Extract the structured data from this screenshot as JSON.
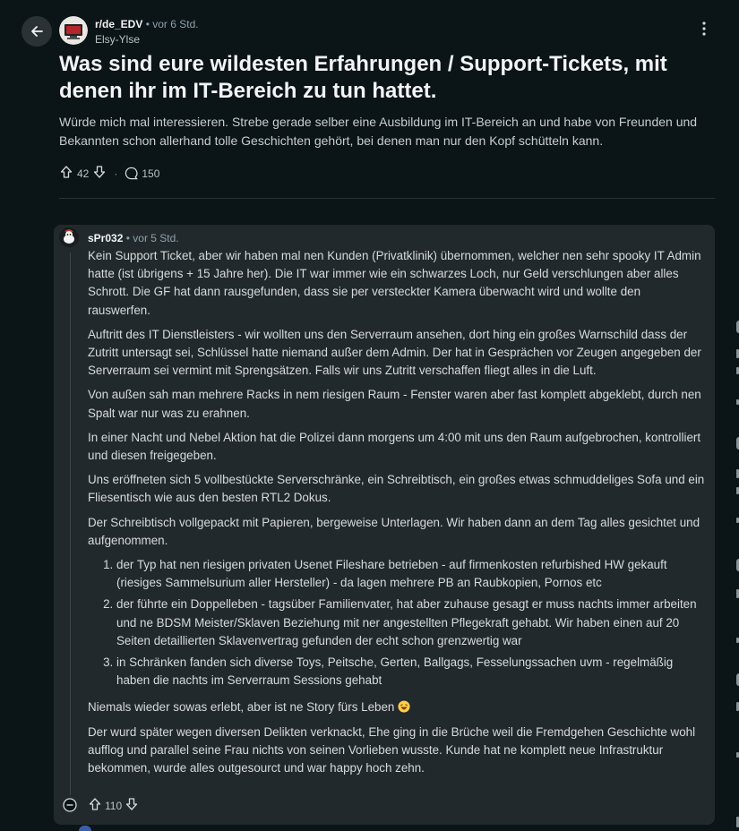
{
  "post": {
    "subreddit": "r/de_EDV",
    "separator": "•",
    "time": "vor 6 Std.",
    "author": "Elsy-Ylse",
    "title": "Was sind eure wildesten Erfahrungen / Support-Tickets, mit denen ihr im IT-Bereich zu tun hattet.",
    "body": "Würde mich mal interessieren. Strebe gerade selber eine Ausbildung im IT-Bereich an und habe von Freunden und Bekannten schon allerhand tolle Geschichten gehört, bei denen man nur den Kopf schütteln kann.",
    "votes": "42",
    "dot_separator": "·",
    "comments": "150"
  },
  "comment": {
    "author": "sPr032",
    "separator": "•",
    "time": "vor 5 Std.",
    "paragraphs": [
      "Kein Support Ticket, aber wir haben mal nen Kunden (Privatklinik) übernommen, welcher nen sehr spooky IT Admin hatte (ist übrigens + 15 Jahre her). Die IT war immer wie ein schwarzes Loch, nur Geld verschlungen aber alles Schrott. Die GF hat dann rausgefunden, dass sie per versteckter Kamera überwacht wird und wollte den rauswerfen.",
      "Auftritt des IT Dienstleisters - wir wollten uns den Serverraum ansehen, dort hing ein großes Warnschild dass der Zutritt untersagt sei, Schlüssel hatte niemand außer dem Admin. Der hat in Gesprächen vor Zeugen angegeben der Serverraum sei vermint mit Sprengsätzen. Falls wir uns Zutritt verschaffen fliegt alles in die Luft.",
      "Von außen sah man mehrere Racks in nem riesigen Raum - Fenster waren aber fast komplett abgeklebt, durch nen Spalt war nur was zu erahnen.",
      "In einer Nacht und Nebel Aktion hat die Polizei dann morgens um 4:00 mit uns den Raum aufgebrochen, kontrolliert und diesen freigegeben.",
      "Uns eröffneten sich 5 vollbestückte Serverschränke, ein Schreibtisch, ein großes etwas schmuddeliges Sofa und ein Fliesentisch wie aus den besten RTL2 Dokus.",
      "Der Schreibtisch vollgepackt mit Papieren, bergeweise Unterlagen. Wir haben dann an dem Tag alles gesichtet und aufgenommen."
    ],
    "list": [
      "der Typ hat nen riesigen privaten Usenet Fileshare betrieben - auf firmenkosten refurbished HW gekauft (riesiges Sammelsurium aller Hersteller) - da lagen mehrere PB an Raubkopien, Pornos etc",
      "der führte ein Doppelleben - tagsüber Familienvater, hat aber zuhause gesagt er muss nachts immer arbeiten und ne BDSM Meister/Sklaven Beziehung mit ner angestellten Pflegekraft gehabt. Wir haben einen auf 20 Seiten detaillierten Sklavenvertrag gefunden der echt schon grenzwertig war",
      "in Schränken fanden sich diverse Toys, Peitsche, Gerten, Ballgags, Fesselungssachen uvm - regelmäßig haben die nachts im Serverraum Sessions gehabt"
    ],
    "closing_1": "Niemals wieder sowas erlebt, aber ist ne Story fürs Leben",
    "closing_2": "Der wurd später wegen diversen Delikten verknackt, Ehe ging in die Brüche weil die Fremdgehen Geschichte wohl aufflog und parallel seine Frau nichts von seinen Vorlieben wusste. Kunde hat ne komplett neue Infrastruktur bekommen, wurde alles outgesourct und war happy hoch zehn.",
    "votes": "110"
  },
  "icons": {
    "back": "arrow-left-icon",
    "more": "more-vertical-icon",
    "upvote": "upvote-arrow-icon",
    "downvote": "downvote-arrow-icon",
    "comments": "speech-bubble-icon",
    "collapse": "collapse-minus-icon",
    "emoji": "laughing-face-emoji"
  },
  "colors": {
    "background": "#0b1416",
    "card": "#22292c",
    "text": "#d7dadc",
    "muted": "#8ba2ad"
  }
}
